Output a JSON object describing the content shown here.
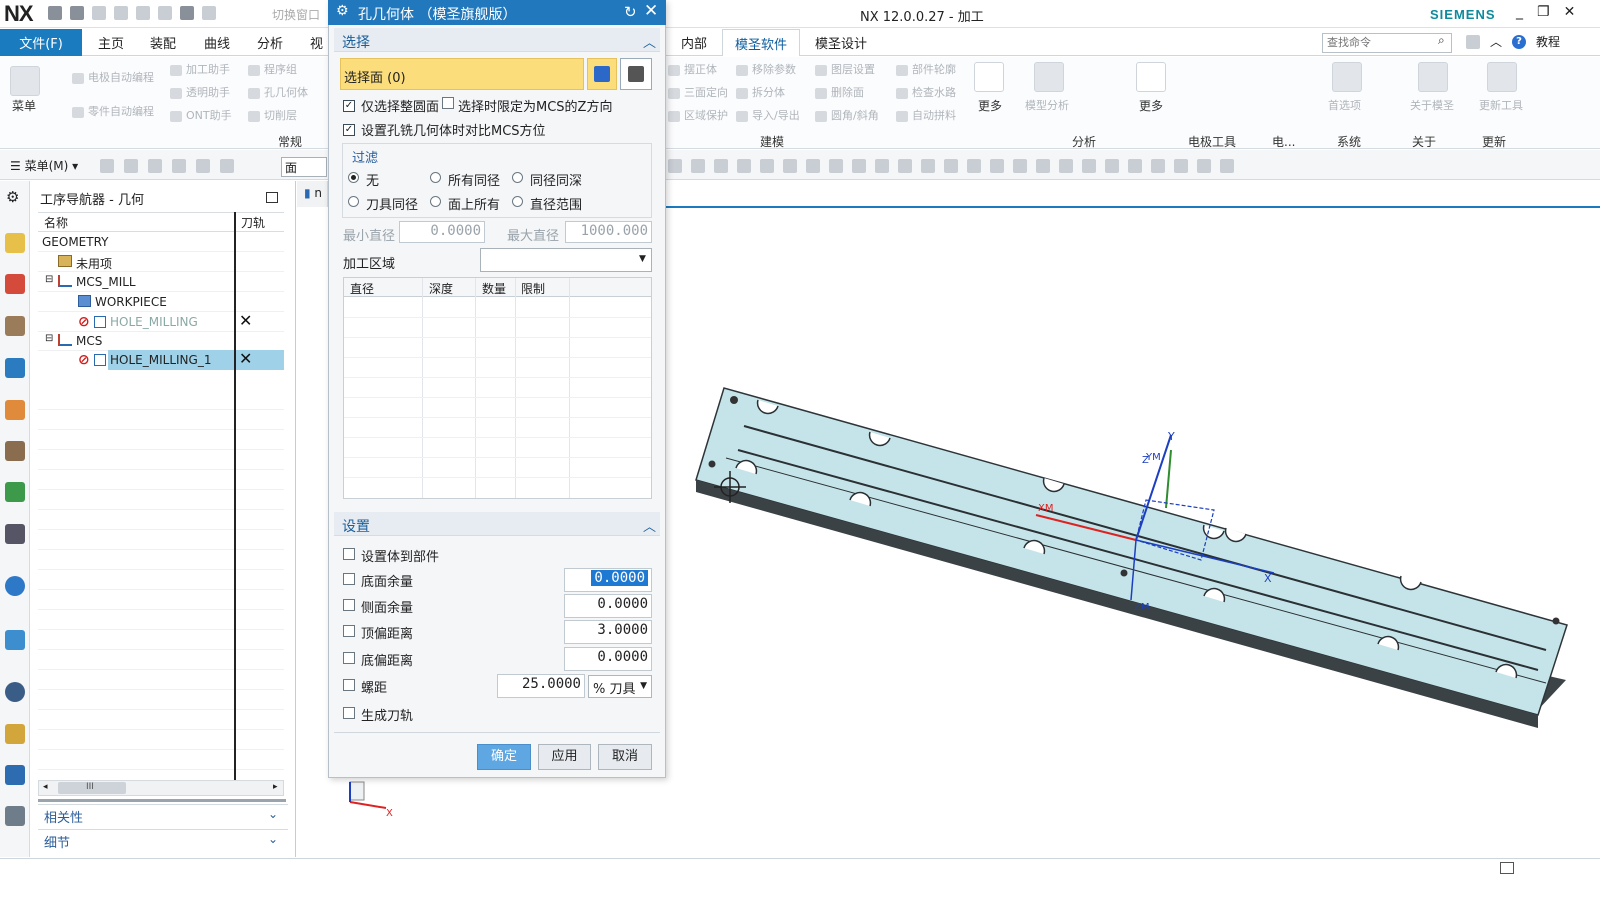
{
  "titlebar": {
    "logo": "NX",
    "switch_window": "切换窗口",
    "app_title": "NX 12.0.0.27 - 加工",
    "brand": "SIEMENS",
    "window_controls": [
      "_",
      "❐",
      "✕"
    ]
  },
  "menubar": {
    "file_tab": "文件(F)",
    "tabs": [
      "主页",
      "装配",
      "曲线",
      "分析",
      "视"
    ],
    "right_tabs": [
      "内部",
      "模圣软件",
      "模圣设计"
    ],
    "active_tab": "模圣软件",
    "search_placeholder": "查找命令",
    "tutorial": "教程"
  },
  "ribbon": {
    "menu_label": "菜单",
    "left_items": [
      "电极自动编程",
      "加工助手",
      "程序组",
      "透明助手",
      "孔几何体",
      "零件自动编程",
      "ONT助手",
      "切削层"
    ],
    "left_group": "常规",
    "model_items": [
      "摆正体",
      "移除参数",
      "图层设置",
      "部件轮廓",
      "三面定向",
      "拆分体",
      "删除面",
      "检查水路",
      "区域保护",
      "导入/导出",
      "圆角/斜角",
      "自动拼料"
    ],
    "more_label": "更多",
    "model_group": "建模",
    "analysis_label": "模型分析",
    "analysis_group": "分析",
    "electrode_group": "电极工具",
    "electrode_short": "电...",
    "prefs_label": "首选项",
    "system_group": "系统",
    "about_label": "关于模圣",
    "about_group": "关于",
    "update_label": "更新工具",
    "update_group": "更新"
  },
  "toolbar2": {
    "menu_label": "菜单(M)",
    "filter_value": "面"
  },
  "navigator": {
    "title": "工序导航器 - 几何",
    "col_name": "名称",
    "col_path": "刀轨",
    "rows": [
      {
        "label": "GEOMETRY"
      },
      {
        "label": "未用项"
      },
      {
        "label": "MCS_MILL"
      },
      {
        "label": "WORKPIECE"
      },
      {
        "label": "HOLE_MILLING",
        "mark": "✕"
      },
      {
        "label": "MCS"
      },
      {
        "label": "HOLE_MILLING_1",
        "mark": "✕"
      }
    ],
    "scroll_grip": "III",
    "accordion": [
      "相关性",
      "细节"
    ]
  },
  "dialog": {
    "title": "孔几何体 （模圣旗舰版）",
    "select_section": "选择",
    "select_face": "选择面 (0)",
    "only_whole_circle": "仅选择整圆面",
    "limit_mcs_z": "选择时限定为MCS的Z方向",
    "compare_mcs": "设置孔铣几何体时对比MCS方位",
    "filter_title": "过滤",
    "filter_options": [
      "无",
      "所有同径",
      "同径同深",
      "刀具同径",
      "面上所有",
      "直径范围"
    ],
    "min_dia_label": "最小直径",
    "min_dia_value": "0.0000",
    "max_dia_label": "最大直径",
    "max_dia_value": "1000.000",
    "area_label": "加工区域",
    "area_value": "",
    "table_cols": [
      "直径",
      "深度",
      "数量",
      "限制"
    ],
    "settings_section": "设置",
    "settings": [
      {
        "label": "设置体到部件"
      },
      {
        "label": "底面余量",
        "value": "0.0000"
      },
      {
        "label": "侧面余量",
        "value": "0.0000"
      },
      {
        "label": "顶偏距离",
        "value": "3.0000"
      },
      {
        "label": "底偏距离",
        "value": "0.0000"
      },
      {
        "label": "螺距",
        "value": "25.0000",
        "unit": "% 刀具"
      },
      {
        "label": "生成刀轨"
      }
    ],
    "buttons": {
      "ok": "确定",
      "apply": "应用",
      "cancel": "取消"
    }
  },
  "viewport": {
    "tab_label": "n",
    "axes": {
      "y": "Y",
      "z": "Z",
      "xm": "XM",
      "ym": "YM",
      "zm": "ZM",
      "x": "X"
    },
    "triad_x": "X"
  }
}
